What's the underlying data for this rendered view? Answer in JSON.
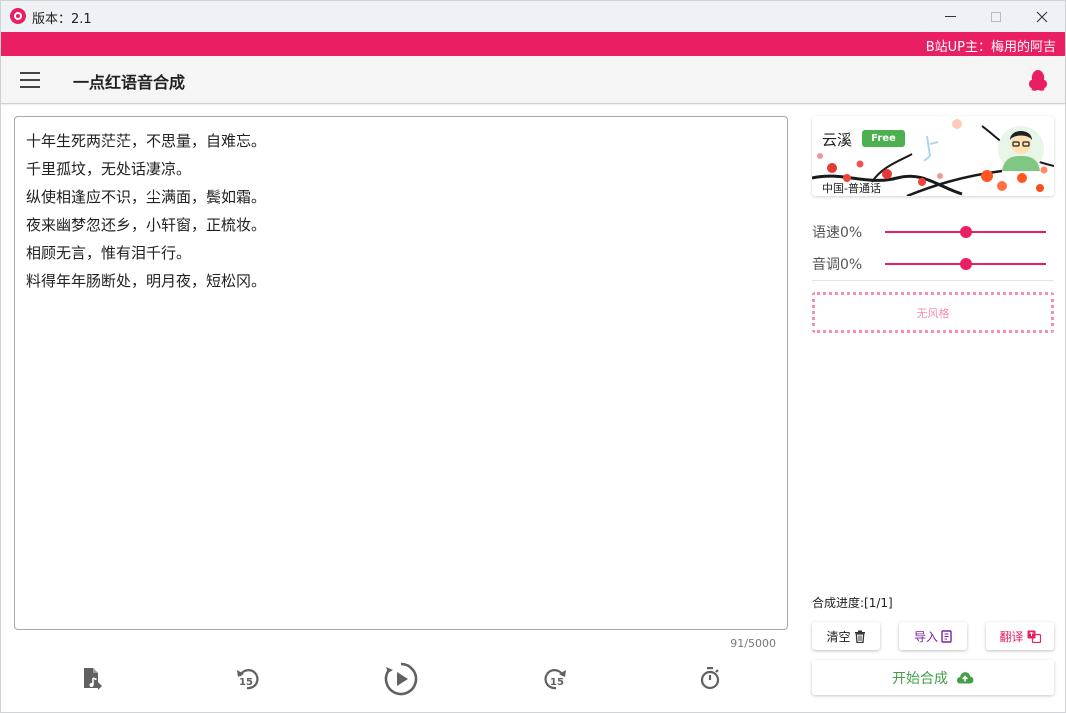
{
  "window": {
    "title": "版本：2.1"
  },
  "banner": {
    "text": "B站UP主：梅用的阿吉"
  },
  "appbar": {
    "title": "一点红语音合成",
    "menu_icon": "hamburger-menu-icon",
    "right_icon": "qq-penguin-icon"
  },
  "editor": {
    "lines": [
      "十年生死两茫茫，不思量，自难忘。",
      "千里孤坟，无处话凄凉。",
      "纵使相逢应不识，尘满面，鬓如霜。",
      "夜来幽梦忽还乡，小轩窗，正梳妆。",
      "相顾无言，惟有泪千行。",
      "料得年年肠断处，明月夜，短松冈。"
    ],
    "char_count": "91/5000"
  },
  "controls": {
    "icons": [
      "music-file-icon",
      "rewind-15-icon",
      "play-circle-icon",
      "forward-15-icon",
      "timer-icon"
    ],
    "skip_label": "15"
  },
  "voice": {
    "name": "云溪",
    "badge": "Free",
    "locale": "中国-普通话"
  },
  "sliders": {
    "rate": {
      "label": "语速0%",
      "value": 0
    },
    "pitch": {
      "label": "音调0%",
      "value": 0
    }
  },
  "style": {
    "label": "无风格"
  },
  "progress": {
    "label": "合成进度:[1/1]"
  },
  "buttons": {
    "clear": "清空",
    "import": "导入",
    "translate": "翻译",
    "start": "开始合成"
  },
  "colors": {
    "accent": "#e91e63",
    "free_badge": "#4caf50",
    "start_text": "#43a047",
    "import_text": "#7b1fa2"
  }
}
